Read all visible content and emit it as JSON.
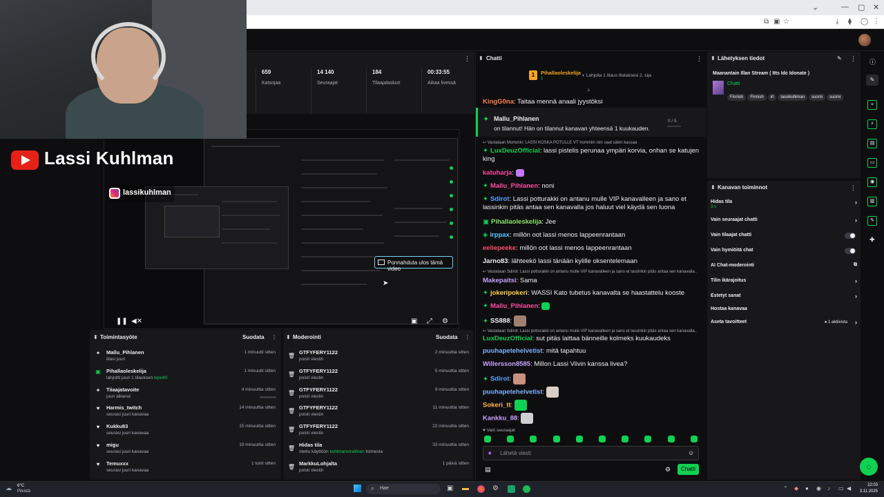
{
  "stats": [
    {
      "value": "659",
      "label": "Katsojaa"
    },
    {
      "value": "14 140",
      "label": "Seuraajat"
    },
    {
      "value": "184",
      "label": "Tilaajalaskuri"
    },
    {
      "value": "00:33:55",
      "label": "Aikaa livessä"
    }
  ],
  "overlay": {
    "brand_name": "Lassi Kuhlman",
    "instagram": "lassikuhlman"
  },
  "video": {
    "popout_label": "Ponnahduta ulos tämä video"
  },
  "activity": {
    "title": "Toimintasyöte",
    "filter": "Suodata",
    "items": [
      {
        "icon": "✦",
        "name": "Mallu_Pihlanen",
        "sub": "tilasi juuri",
        "time": "1 minuutti sitten"
      },
      {
        "icon": "▣",
        "name": "Pihallaoleskelija",
        "sub": "lahjoitti juuri 1 tilauksen ",
        "sub_highlight": "lepu40",
        "time": "1 minuutti sitten"
      },
      {
        "icon": "✦",
        "name": "Tiiaajatavoite",
        "sub": "juuri alkanut",
        "time": "4 minuuttia sitten"
      },
      {
        "icon": "♥",
        "name": "Harmis_twitch",
        "sub": "seurasi juuri kanavaa",
        "time": "14 minuuttia sitten"
      },
      {
        "icon": "♥",
        "name": "Kukku83",
        "sub": "seurasi juuri kanavaa",
        "time": "15 minuuttia sitten"
      },
      {
        "icon": "♥",
        "name": "migu",
        "sub": "seurasi juuri kanavaa",
        "time": "19 minuuttia sitten"
      },
      {
        "icon": "♥",
        "name": "Temuxxx",
        "sub": "seurasi juuri kanavaa",
        "time": "1 tunti sitten"
      }
    ]
  },
  "moderation": {
    "title": "Moderointi",
    "filter": "Suodata",
    "items": [
      {
        "name": "GTFYFERY1122",
        "sub": "poisti viestin",
        "time": "2 minuuttia sitten"
      },
      {
        "name": "GTFYFERY1122",
        "sub": "poisti viestin",
        "time": "5 minuuttia sitten"
      },
      {
        "name": "GTFYFERY1122",
        "sub": "poisti viestin",
        "time": "9 minuuttia sitten"
      },
      {
        "name": "GTFYFERY1122",
        "sub": "poisti viestin",
        "time": "11 minuuttia sitten"
      },
      {
        "name": "GTFYFERY1122",
        "sub": "poisti viestin",
        "time": "22 minuuttia sitten"
      },
      {
        "name": "Hidas tila",
        "sub": "otettu käyttöön ",
        "sub_highlight": "kuhlmanvirallinen",
        "sub_tail": " toimesta",
        "time": "33 minuuttia sitten"
      },
      {
        "name": "MarkkuLohjalta",
        "sub": "poisti viestin",
        "time": "1 päivä sitten"
      }
    ]
  },
  "chat": {
    "title": "Chatti",
    "pinned_user": "Pihallaoleskelija",
    "pinned_count": "1",
    "pinned_text": "Lahjoita 1 tilaus tilataksesi 2. sija",
    "sub_alert_user": "Mallu_Pihlanen",
    "sub_alert_text": "on tilannut! Hän on tilannut kanavan yhteensä 1 kuukauden.",
    "sub_alert_progress": "0 / 5",
    "messages": [
      {
        "user": "KingG0na",
        "color": "#ff7f50",
        "text": ": Taitaa mennä anaali jyystöksi"
      },
      {
        "reply": "Vastataan Mortonki: LASSI KOSKA POTULLE VT hommiin niin saat säkin kassaa"
      },
      {
        "user": "LuxDeuzOfficial",
        "color": "#0fd152",
        "text": ": lassi pistelis perunaa ympäri korvia, onhan se katujen king"
      },
      {
        "user": "katuharja",
        "color": "#ff4da6",
        "text": ":"
      },
      {
        "user": "Mallu_Pihlanen",
        "color": "#ff4da6",
        "text": ": noni"
      },
      {
        "user": "Sdirot",
        "color": "#5aa0ff",
        "text": ": Lassi potturakki on antanu mulle VIP kanavalleen ja sano et lassinkin pitäs antaa sen kanavalla jos haluut viel käydä sen luona"
      },
      {
        "user": "Pihallaoleskelija",
        "color": "#8ee26a",
        "text": ": Jee"
      },
      {
        "user": "irppax",
        "color": "#5fc8ff",
        "text": ": millön oot lassi menos lappeenrantaan"
      },
      {
        "user": "eeliepeeke",
        "color": "#ff4d6a",
        "text": ": millön oot lassi menos lappeenrantaan"
      },
      {
        "user": "Jarno83",
        "color": "#efeff1",
        "text": ": lähteekö lassi tänään kylille oksentelemaan"
      },
      {
        "reply": "Vastataan Sdirot: Lassi potturakki on antanu mulle VIP kanavalleen ja sano et lassinkin pitäs antaa sen kanavalla..."
      },
      {
        "user": "Makepaitsi",
        "color": "#c9a0ff",
        "text": ": Sama"
      },
      {
        "user": "jokeripokeri",
        "color": "#ffd24d",
        "text": ": WASSI Kato tubetus kanavalta se haastattelu kooste"
      },
      {
        "user": "Mallu_Pihlanen",
        "color": "#ff4da6",
        "text": ":"
      },
      {
        "user": "SS888",
        "color": "#efeff1",
        "text": ":"
      },
      {
        "reply": "Vastataan Sdirot: Lassi potturakki on antanu mulle VIP kanavalleen ja sano et lassinkin pitäs antaa sen kanavalla..."
      },
      {
        "user": "LuxDeuzOfficial",
        "color": "#0fd152",
        "text": ": sut pitäs laittaa bänneille kolmeks kuukaudeks"
      },
      {
        "user": "puuhapetehelvetist",
        "color": "#7fb2ff",
        "text": ": mitä tapahtuu"
      },
      {
        "user": "Willersson8585",
        "color": "#c9a0ff",
        "text": ": Millon Lassi Viivin kanssa livea?"
      },
      {
        "user": "Sdirot",
        "color": "#5aa0ff",
        "text": ":"
      },
      {
        "user": "puuhapetehelvetist",
        "color": "#7fb2ff",
        "text": ":"
      },
      {
        "user": "Sokeri_tt",
        "color": "#ffb84d",
        "text": ":"
      },
      {
        "user": "Kankku_88",
        "color": "#c9a0ff",
        "text": ":"
      }
    ],
    "followers_only": "Vain seuraajat",
    "input_placeholder": "Lähetä viesti",
    "send_label": "Chatti"
  },
  "stream_info": {
    "title": "Lähetyksen tiedot",
    "stream_title": "Maanantain Illan Stream ( Itts Idc Idonate )",
    "category": "Chatti",
    "tags": [
      "Finnish",
      "Finnish",
      "irl",
      "lassikuhlman",
      "suomi",
      "suomi"
    ]
  },
  "channel_actions": {
    "title": "Kanavan toiminnot",
    "rows": [
      {
        "label": "Hidas tila",
        "sub": "3 s",
        "control": "chevron"
      },
      {
        "label": "Vain seuraajat chatti",
        "control": "chevron"
      },
      {
        "label": "Vain tilaajat chatti",
        "control": "toggle"
      },
      {
        "label": "Vain hymiöitä chat",
        "control": "toggle"
      },
      {
        "label": "AI Chat-moderointi",
        "control": "external"
      },
      {
        "label": "Tilin ikärajoitus",
        "control": "chevron"
      },
      {
        "label": "Estetyt sanat",
        "control": "chevron"
      },
      {
        "label": "Hostaa kanavaa",
        "control": "none"
      },
      {
        "label": "Aseta tavoitteet",
        "badge": "1 aktiivista",
        "control": "chevron"
      }
    ]
  },
  "taskbar": {
    "weather_temp": "6°C",
    "weather_desc": "Pilvistä",
    "search": "Hae",
    "time": "22:03",
    "date": "3.11.2025"
  }
}
